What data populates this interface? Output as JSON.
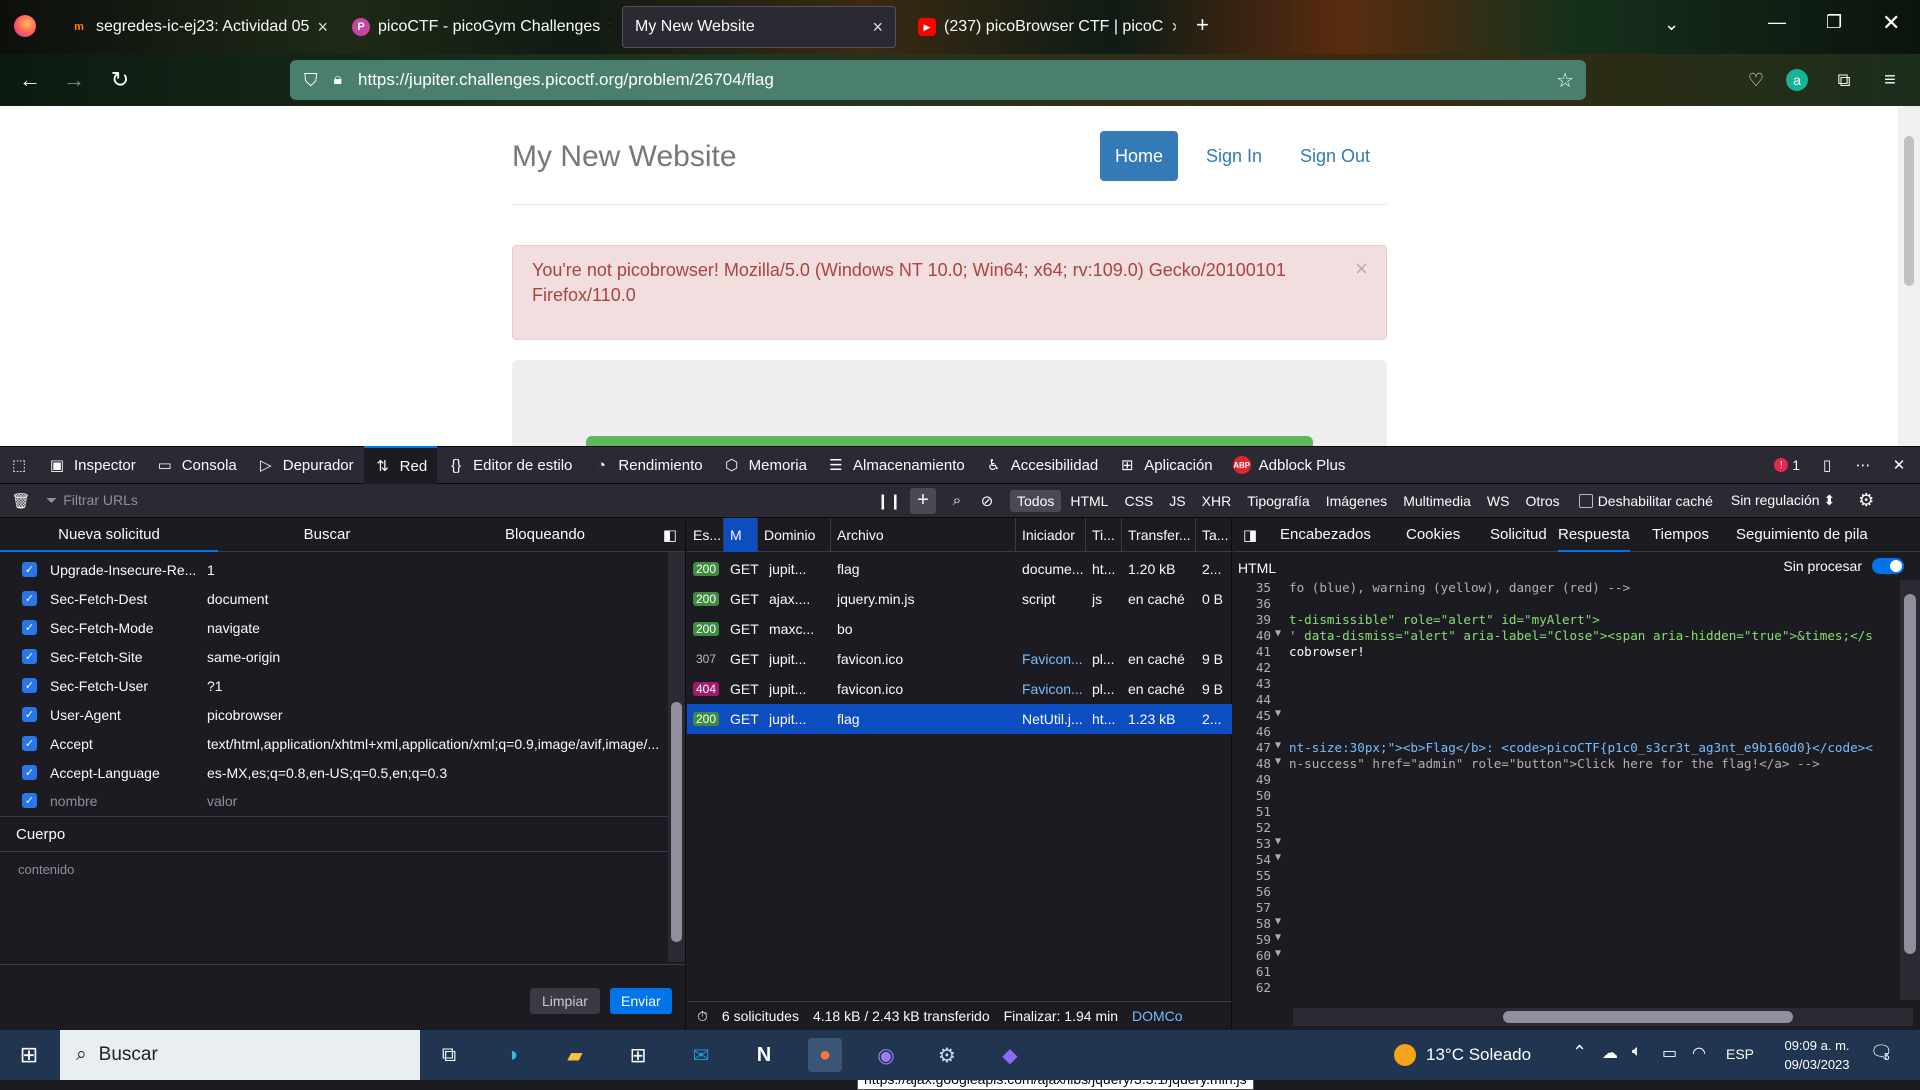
{
  "browser": {
    "tabs": [
      {
        "title": "segredes-ic-ej23: Actividad 05",
        "icon": "moodle-icon",
        "active": false
      },
      {
        "title": "picoCTF - picoGym Challenges",
        "icon": "picoctf-icon",
        "active": false
      },
      {
        "title": "My New Website",
        "icon": "",
        "active": true
      },
      {
        "title": "(237) picoBrowser CTF | picoC",
        "icon": "youtube-icon",
        "active": false
      }
    ],
    "url": "https://jupiter.challenges.picoctf.org/problem/26704/flag"
  },
  "page": {
    "brand": "My New Website",
    "nav": {
      "home": "Home",
      "sign_in": "Sign In",
      "sign_out": "Sign Out"
    },
    "alert_text": "You're not picobrowser! Mozilla/5.0 (Windows NT 10.0; Win64; x64; rv:109.0) Gecko/20100101 Firefox/110.0",
    "alert_close": "×"
  },
  "devtools": {
    "tools": [
      "Inspector",
      "Consola",
      "Depurador",
      "Red",
      "Editor de estilo",
      "Rendimiento",
      "Memoria",
      "Almacenamiento",
      "Accesibilidad",
      "Aplicación",
      "Adblock Plus"
    ],
    "error_count": "1",
    "filter_placeholder": "Filtrar URLs",
    "filter_types": [
      "Todos",
      "HTML",
      "CSS",
      "JS",
      "XHR",
      "Tipografía",
      "Imágenes",
      "Multimedia",
      "WS",
      "Otros"
    ],
    "disable_cache": "Deshabilitar caché",
    "throttling": "Sin regulación ⬍",
    "left_tabs": [
      "Nueva solicitud",
      "Buscar",
      "Bloqueando"
    ],
    "headers": [
      {
        "name": "Upgrade-Insecure-Re...",
        "value": "1"
      },
      {
        "name": "Sec-Fetch-Dest",
        "value": "document"
      },
      {
        "name": "Sec-Fetch-Mode",
        "value": "navigate"
      },
      {
        "name": "Sec-Fetch-Site",
        "value": "same-origin"
      },
      {
        "name": "Sec-Fetch-User",
        "value": "?1"
      },
      {
        "name": "User-Agent",
        "value": "picobrowser"
      },
      {
        "name": "Accept",
        "value": "text/html,application/xhtml+xml,application/xml;q=0.9,image/avif,image/..."
      },
      {
        "name": "Accept-Language",
        "value": "es-MX,es;q=0.8,en-US;q=0.5,en;q=0.3"
      }
    ],
    "new_header": {
      "name": "nombre",
      "value": "valor"
    },
    "body_label": "Cuerpo",
    "body_placeholder": "contenido",
    "clear_btn": "Limpiar",
    "send_btn": "Enviar",
    "columns": [
      "Es...",
      "M",
      "Dominio",
      "Archivo",
      "Iniciador",
      "Ti...",
      "Transfer...",
      "Ta..."
    ],
    "requests": [
      {
        "status": "200",
        "method": "GET",
        "domain": "jupit...",
        "file": "flag",
        "initiator": "docume...",
        "type": "ht...",
        "transfer": "1.20 kB",
        "size": "2..."
      },
      {
        "status": "200",
        "method": "GET",
        "domain": "ajax....",
        "file": "jquery.min.js",
        "initiator": "script",
        "type": "js",
        "transfer": "en caché",
        "size": "0 B"
      },
      {
        "status": "200",
        "method": "GET",
        "domain": "maxc...",
        "file": "bo",
        "initiator": "",
        "type": "",
        "transfer": "",
        "size": ""
      },
      {
        "status": "307",
        "method": "GET",
        "domain": "jupit...",
        "file": "favicon.ico",
        "initiator": "Favicon...",
        "type": "pl...",
        "transfer": "en caché",
        "size": "9 B"
      },
      {
        "status": "404",
        "method": "GET",
        "domain": "jupit...",
        "file": "favicon.ico",
        "initiator": "Favicon...",
        "type": "pl...",
        "transfer": "en caché",
        "size": "9 B"
      },
      {
        "status": "200",
        "method": "GET",
        "domain": "jupit...",
        "file": "flag",
        "initiator": "NetUtil.j...",
        "type": "ht...",
        "transfer": "1.23 kB",
        "size": "2..."
      }
    ],
    "tooltip": "https://ajax.googleapis.com/ajax/libs/jquery/3.3.1/jquery.min.js",
    "summary": {
      "requests": "6 solicitudes",
      "transferred": "4.18 kB / 2.43 kB transferido",
      "finish": "Finalizar: 1.94 min",
      "dom": "DOMCo"
    },
    "detail_tabs": [
      "Encabezados",
      "Cookies",
      "Solicitud",
      "Respuesta",
      "Tiempos",
      "Seguimiento de pila"
    ],
    "response_mode": "HTML",
    "raw_label": "Sin procesar",
    "code_lines": [
      {
        "n": "35",
        "t": "fo (blue), warning (yellow), danger (red) -->"
      },
      {
        "n": "36",
        "t": ""
      },
      {
        "n": "39",
        "t": "t-dismissible\" role=\"alert\" id=\"myAlert\">"
      },
      {
        "n": "40",
        "t": "' data-dismiss=\"alert\" aria-label=\"Close\"><span aria-hidden=\"true\">&times;</s"
      },
      {
        "n": "41",
        "t": "cobrowser!"
      },
      {
        "n": "42",
        "t": ""
      },
      {
        "n": "43",
        "t": ""
      },
      {
        "n": "44",
        "t": ""
      },
      {
        "n": "45",
        "t": ""
      },
      {
        "n": "46",
        "t": ""
      },
      {
        "n": "47",
        "t": "nt-size:30px;\"><b>Flag</b>: <code>picoCTF{p1c0_s3cr3t_ag3nt_e9b160d0}</code><"
      },
      {
        "n": "48",
        "t": "n-success\" href=\"admin\" role=\"button\">Click here for the flag!</a> -->"
      },
      {
        "n": "49",
        "t": ""
      },
      {
        "n": "50",
        "t": ""
      },
      {
        "n": "51",
        "t": ""
      },
      {
        "n": "52",
        "t": ""
      },
      {
        "n": "53",
        "t": ""
      },
      {
        "n": "54",
        "t": ""
      },
      {
        "n": "55",
        "t": ""
      },
      {
        "n": "56",
        "t": ""
      },
      {
        "n": "57",
        "t": ""
      },
      {
        "n": "58",
        "t": ""
      },
      {
        "n": "59",
        "t": ""
      },
      {
        "n": "60",
        "t": ""
      },
      {
        "n": "61",
        "t": ""
      },
      {
        "n": "62",
        "t": ""
      }
    ]
  },
  "taskbar": {
    "search": "Buscar",
    "weather": "13°C  Soleado",
    "lang": "ESP",
    "time": "09:09 a. m.",
    "date": "09/03/2023",
    "notif": "5"
  }
}
